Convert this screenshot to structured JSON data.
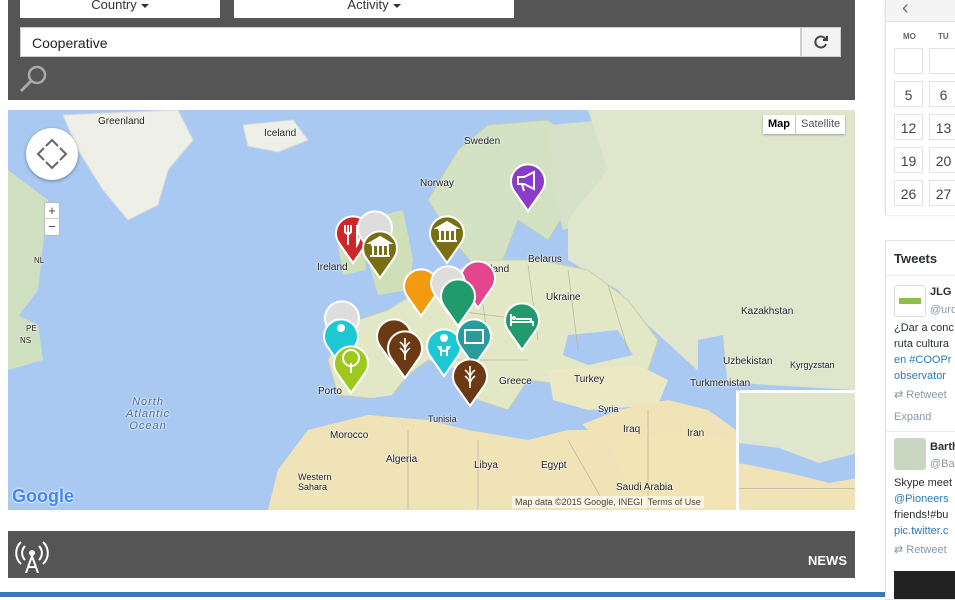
{
  "filters": {
    "country_label": "Country",
    "activity_label": "Activity",
    "keyword_value": "Cooperative"
  },
  "map": {
    "type_map_label": "Map",
    "type_satellite_label": "Satellite",
    "logo": "Google",
    "attribution": "Map data ©2015 Google, INEGI",
    "terms": "Terms of Use",
    "labels": {
      "greenland": "Greenland",
      "iceland": "Iceland",
      "sweden": "Sweden",
      "norway": "Norway",
      "ireland": "Ireland",
      "poland": "Poland",
      "belarus": "Belarus",
      "ukraine": "Ukraine",
      "kazakhstan": "Kazakhstan",
      "uzbekistan": "Uzbekistan",
      "kyrgyzstan": "Kyrgyzstan",
      "turkmenistan": "Turkmenistan",
      "turkey": "Turkey",
      "greece": "Greece",
      "syria": "Syria",
      "iraq": "Iraq",
      "iran": "Iran",
      "tunisia": "Tunisia",
      "morocco": "Morocco",
      "algeria": "Algeria",
      "libya": "Libya",
      "egypt": "Egypt",
      "saudi": "Saudi Arabia",
      "western_sahara": "Western\nSahara",
      "porto": "Porto",
      "nl": "NL",
      "pe": "PE",
      "ns": "NS",
      "atlantic": "North\nAtlantic\nOcean"
    },
    "pin_icons": [
      "fork-knife-icon",
      "museum-icon",
      "megaphone-icon",
      "bed-icon",
      "tree-icon",
      "wheat-icon",
      "person-icon",
      "suitcase-icon"
    ],
    "colors": {
      "red": "#d0262a",
      "olive": "#7a6e12",
      "purple": "#8a3cc8",
      "green": "#1f9b6e",
      "lime": "#9ec81e",
      "brown": "#6b3a12",
      "cyan": "#1ec8d2",
      "teal": "#2a9a9a",
      "orange": "#f29a10",
      "pink": "#e4468e"
    }
  },
  "news": {
    "title": "NEWS"
  },
  "calendar": {
    "dow": [
      "MO",
      "TU"
    ],
    "days": [
      [
        "",
        ""
      ],
      [
        "5",
        "6"
      ],
      [
        "12",
        "13"
      ],
      [
        "19",
        "20"
      ],
      [
        "26",
        "27"
      ]
    ]
  },
  "tweets": {
    "title": "Tweets",
    "t1": {
      "name": "JLG",
      "handle": "@uro",
      "lines": [
        "¿Dar a conc",
        "ruta cultura",
        "en #COOPr",
        "observator"
      ],
      "retweet": "Retweet",
      "expand": "Expand"
    },
    "t2": {
      "name": "Barth",
      "handle": "@Ba",
      "lines": [
        "Skype meet",
        "@Pioneers",
        "friends!#bu",
        "pic.twitter.c"
      ],
      "retweet": "Retweet"
    }
  }
}
